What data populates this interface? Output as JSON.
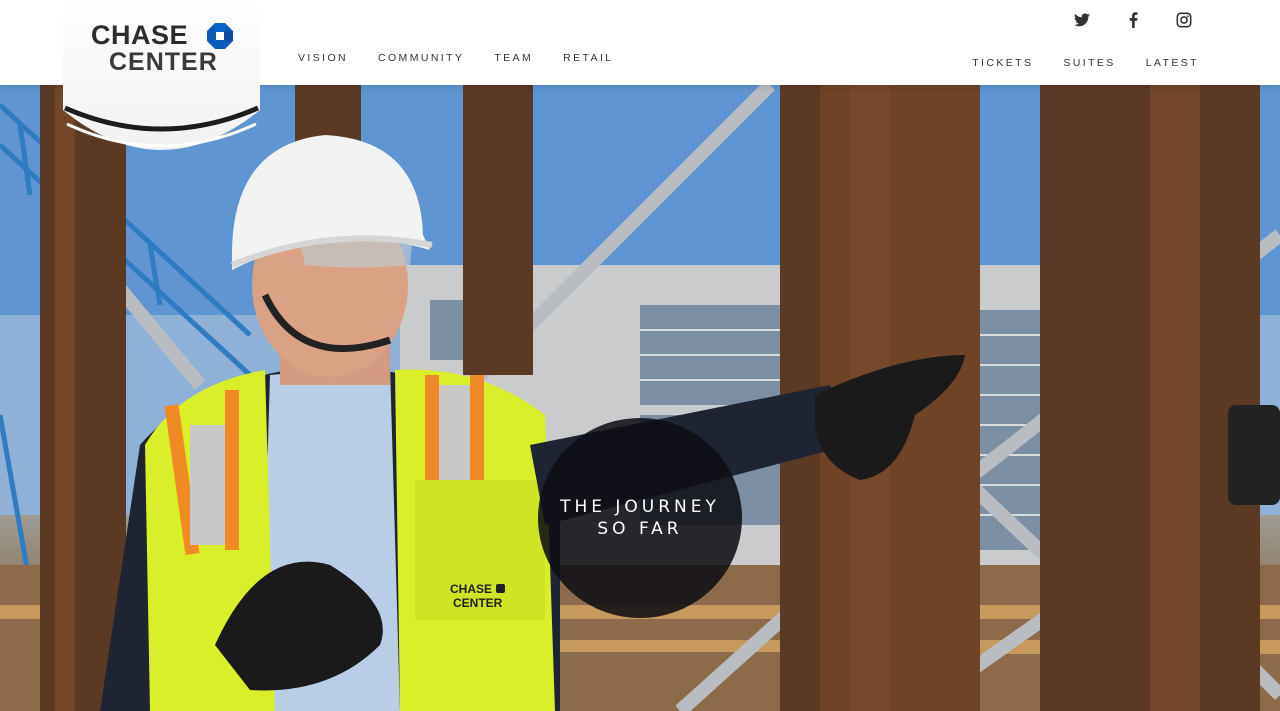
{
  "brand": {
    "line1": "CHASE",
    "line2": "CENTER",
    "accent": "#0a5cb8"
  },
  "nav_left": [
    "VISION",
    "COMMUNITY",
    "TEAM",
    "RETAIL"
  ],
  "nav_right": [
    "TICKETS",
    "SUITES",
    "LATEST"
  ],
  "social": [
    "twitter-icon",
    "facebook-icon",
    "instagram-icon"
  ],
  "hero": {
    "cta_line1": "THE JOURNEY",
    "cta_line2": "SO FAR",
    "vest_logo_line1": "CHASE",
    "vest_logo_line2": "CENTER"
  }
}
